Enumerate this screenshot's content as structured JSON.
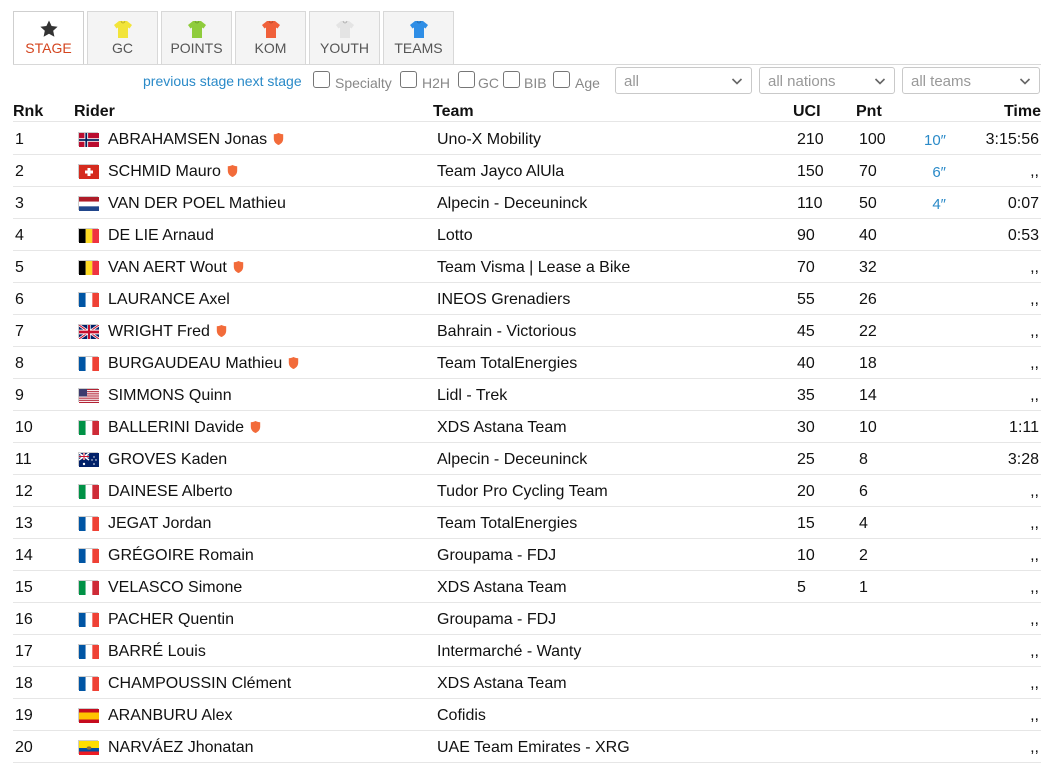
{
  "tabs": [
    {
      "label": "STAGE",
      "icon": "star-icon",
      "color": "#333333",
      "active": true
    },
    {
      "label": "GC",
      "icon": "jersey-icon",
      "color": "#f2e43a",
      "active": false
    },
    {
      "label": "POINTS",
      "icon": "jersey-icon",
      "color": "#8fcc3c",
      "active": false
    },
    {
      "label": "KOM",
      "icon": "jersey-icon",
      "color": "#f0603a",
      "active": false
    },
    {
      "label": "YOUTH",
      "icon": "jersey-icon",
      "color": "#e4e4e4",
      "active": false
    },
    {
      "label": "TEAMS",
      "icon": "jersey-icon",
      "color": "#2f8ee6",
      "active": false
    }
  ],
  "filters": {
    "previous_stage": "previous stage",
    "next_stage": "next stage",
    "checkboxes": [
      "Specialty",
      "H2H",
      "GC",
      "BIB",
      "Age"
    ],
    "selects": [
      "all",
      "all nations",
      "all teams"
    ]
  },
  "table": {
    "headers": {
      "rnk": "Rnk",
      "rider": "Rider",
      "team": "Team",
      "uci": "UCI",
      "pnt": "Pnt",
      "time": "Time"
    },
    "rows": [
      {
        "rnk": "1",
        "flag": "NO",
        "rider": "ABRAHAMSEN Jonas",
        "shield": true,
        "team": "Uno-X Mobility",
        "uci": "210",
        "pnt": "100",
        "bonus": "10″",
        "time": "3:15:56"
      },
      {
        "rnk": "2",
        "flag": "CH",
        "rider": "SCHMID Mauro",
        "shield": true,
        "team": "Team Jayco AlUla",
        "uci": "150",
        "pnt": "70",
        "bonus": "6″",
        "time": ",,"
      },
      {
        "rnk": "3",
        "flag": "NL",
        "rider": "VAN DER POEL Mathieu",
        "shield": false,
        "team": "Alpecin - Deceuninck",
        "uci": "110",
        "pnt": "50",
        "bonus": "4″",
        "time": "0:07"
      },
      {
        "rnk": "4",
        "flag": "BE",
        "rider": "DE LIE Arnaud",
        "shield": false,
        "team": "Lotto",
        "uci": "90",
        "pnt": "40",
        "bonus": "",
        "time": "0:53"
      },
      {
        "rnk": "5",
        "flag": "BE",
        "rider": "VAN AERT Wout",
        "shield": true,
        "team": "Team Visma | Lease a Bike",
        "uci": "70",
        "pnt": "32",
        "bonus": "",
        "time": ",,"
      },
      {
        "rnk": "6",
        "flag": "FR",
        "rider": "LAURANCE Axel",
        "shield": false,
        "team": "INEOS Grenadiers",
        "uci": "55",
        "pnt": "26",
        "bonus": "",
        "time": ",,"
      },
      {
        "rnk": "7",
        "flag": "GB",
        "rider": "WRIGHT Fred",
        "shield": true,
        "team": "Bahrain - Victorious",
        "uci": "45",
        "pnt": "22",
        "bonus": "",
        "time": ",,"
      },
      {
        "rnk": "8",
        "flag": "FR",
        "rider": "BURGAUDEAU Mathieu",
        "shield": true,
        "team": "Team TotalEnergies",
        "uci": "40",
        "pnt": "18",
        "bonus": "",
        "time": ",,"
      },
      {
        "rnk": "9",
        "flag": "US",
        "rider": "SIMMONS Quinn",
        "shield": false,
        "team": "Lidl - Trek",
        "uci": "35",
        "pnt": "14",
        "bonus": "",
        "time": ",,"
      },
      {
        "rnk": "10",
        "flag": "IT",
        "rider": "BALLERINI Davide",
        "shield": true,
        "team": "XDS Astana Team",
        "uci": "30",
        "pnt": "10",
        "bonus": "",
        "time": "1:11"
      },
      {
        "rnk": "11",
        "flag": "AU",
        "rider": "GROVES Kaden",
        "shield": false,
        "team": "Alpecin - Deceuninck",
        "uci": "25",
        "pnt": "8",
        "bonus": "",
        "time": "3:28"
      },
      {
        "rnk": "12",
        "flag": "IT",
        "rider": "DAINESE Alberto",
        "shield": false,
        "team": "Tudor Pro Cycling Team",
        "uci": "20",
        "pnt": "6",
        "bonus": "",
        "time": ",,"
      },
      {
        "rnk": "13",
        "flag": "FR",
        "rider": "JEGAT Jordan",
        "shield": false,
        "team": "Team TotalEnergies",
        "uci": "15",
        "pnt": "4",
        "bonus": "",
        "time": ",,"
      },
      {
        "rnk": "14",
        "flag": "FR",
        "rider": "GRÉGOIRE Romain",
        "shield": false,
        "team": "Groupama - FDJ",
        "uci": "10",
        "pnt": "2",
        "bonus": "",
        "time": ",,"
      },
      {
        "rnk": "15",
        "flag": "IT",
        "rider": "VELASCO Simone",
        "shield": false,
        "team": "XDS Astana Team",
        "uci": "5",
        "pnt": "1",
        "bonus": "",
        "time": ",,"
      },
      {
        "rnk": "16",
        "flag": "FR",
        "rider": "PACHER Quentin",
        "shield": false,
        "team": "Groupama - FDJ",
        "uci": "",
        "pnt": "",
        "bonus": "",
        "time": ",,"
      },
      {
        "rnk": "17",
        "flag": "FR",
        "rider": "BARRÉ Louis",
        "shield": false,
        "team": "Intermarché - Wanty",
        "uci": "",
        "pnt": "",
        "bonus": "",
        "time": ",,"
      },
      {
        "rnk": "18",
        "flag": "FR",
        "rider": "CHAMPOUSSIN Clément",
        "shield": false,
        "team": "XDS Astana Team",
        "uci": "",
        "pnt": "",
        "bonus": "",
        "time": ",,"
      },
      {
        "rnk": "19",
        "flag": "ES",
        "rider": "ARANBURU Alex",
        "shield": false,
        "team": "Cofidis",
        "uci": "",
        "pnt": "",
        "bonus": "",
        "time": ",,"
      },
      {
        "rnk": "20",
        "flag": "EC",
        "rider": "NARVÁEZ Jhonatan",
        "shield": false,
        "team": "UAE Team Emirates - XRG",
        "uci": "",
        "pnt": "",
        "bonus": "",
        "time": ",,"
      }
    ]
  },
  "colors": {
    "accent": "#d4451f",
    "link": "#2a8ac8",
    "shield": "#f26b3a"
  }
}
